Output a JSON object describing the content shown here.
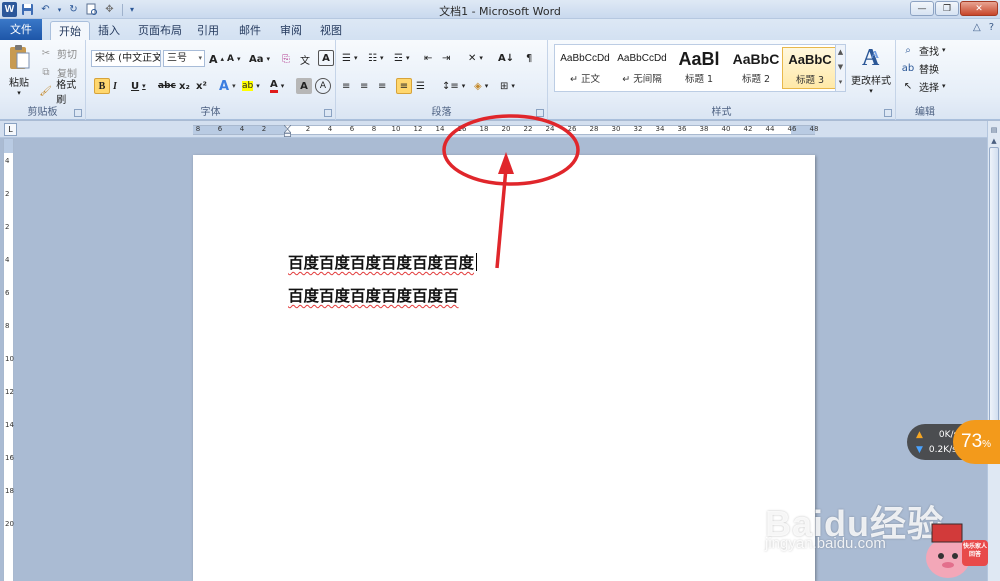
{
  "window": {
    "title": "文档1 - Microsoft Word"
  },
  "tabs": {
    "file": "文件",
    "items": [
      "开始",
      "插入",
      "页面布局",
      "引用",
      "邮件",
      "审阅",
      "视图"
    ],
    "active": "开始"
  },
  "ribbon": {
    "clipboard": {
      "label": "剪贴板",
      "paste": "粘贴",
      "cut": "剪切",
      "copy": "复制",
      "format_painter": "格式刷"
    },
    "font": {
      "label": "字体",
      "font_name": "宋体 (中文正文",
      "font_size": "三号",
      "grow": "A",
      "shrink": "A",
      "change_case": "Aa",
      "clear_format": "A",
      "bold": "B",
      "italic": "I",
      "underline": "U",
      "strike": "abc",
      "subscript": "x₂",
      "superscript": "x²",
      "text_effects": "A",
      "highlight": "ab",
      "font_color": "A",
      "char_shading": "A",
      "enclose": "A",
      "phonetic": "文",
      "char_border": "A"
    },
    "paragraph": {
      "label": "段落"
    },
    "styles": {
      "label": "样式",
      "items": [
        {
          "sample": "AaBbCcDd",
          "name": "↵ 正文"
        },
        {
          "sample": "AaBbCcDd",
          "name": "↵ 无间隔"
        },
        {
          "sample": "AaBl",
          "name": "标题 1"
        },
        {
          "sample": "AaBbC",
          "name": "标题 2"
        },
        {
          "sample": "AaBbC",
          "name": "标题 3"
        }
      ],
      "change_styles": "更改样式"
    },
    "editing": {
      "label": "编辑",
      "find": "查找",
      "replace": "替换",
      "select": "选择"
    }
  },
  "ruler": {
    "left_labels": [
      "8",
      "6",
      "4",
      "2"
    ],
    "right_labels": [
      "2",
      "4",
      "6",
      "8",
      "10",
      "12",
      "14",
      "16",
      "18",
      "20",
      "22",
      "24",
      "26",
      "28",
      "30",
      "32",
      "34",
      "36",
      "38",
      "40",
      "42",
      "44",
      "46",
      "48"
    ],
    "vertical_labels": [
      "4",
      "2",
      "2",
      "4",
      "6",
      "8",
      "10",
      "12",
      "14",
      "16",
      "18",
      "20"
    ]
  },
  "document": {
    "lines": [
      "百度百度百度百度百度百度",
      "百度百度百度百度百度百"
    ]
  },
  "network_widget": {
    "upload": "0K/s",
    "download": "0.2K/s",
    "percent": "73",
    "percent_unit": "%"
  },
  "watermark": {
    "brand": "Baidu经验",
    "url": "jingyan.baidu.com",
    "mascot_text": "快乐家人 回答"
  },
  "colors": {
    "file_tab": "#2b61b4",
    "annotation_red": "#e0262b",
    "widget_orange": "#f39a1b",
    "selected_style": "#ffe9a8"
  }
}
